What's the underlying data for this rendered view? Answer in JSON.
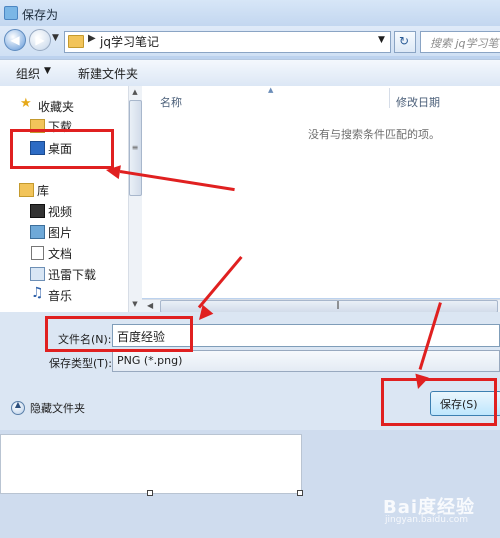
{
  "window": {
    "title": "保存为"
  },
  "address": {
    "crumb": "jq学习笔记",
    "search_placeholder": "搜索 jq学习笔记"
  },
  "toolbar": {
    "organize_label": "组织",
    "new_folder_label": "新建文件夹"
  },
  "nav": {
    "favorites_label": "收藏夹",
    "downloads_label": "下载",
    "desktop_label": "桌面",
    "libraries_label": "库",
    "videos_label": "视频",
    "pictures_label": "图片",
    "documents_label": "文档",
    "thunder_label": "迅雷下载",
    "music_label": "音乐"
  },
  "list": {
    "col_name": "名称",
    "col_date": "修改日期",
    "empty_message": "没有与搜索条件匹配的项。"
  },
  "form": {
    "filename_label": "文件名(N):",
    "filename_value": "百度经验",
    "filetype_label": "保存类型(T):",
    "filetype_value": "PNG (*.png)",
    "hide_folders_label": "隐藏文件夹",
    "save_label": "保存(S)"
  },
  "watermark": {
    "main": "Bai度经验",
    "sub": "jingyan.baidu.com"
  },
  "colors": {
    "callout_red": "#e02020",
    "frame_blue": "#bcd2ee"
  },
  "icons": [
    "back-arrow-icon",
    "forward-arrow-icon",
    "folder-icon",
    "refresh-icon",
    "star-icon",
    "download-folder-icon",
    "desktop-icon",
    "library-icon",
    "video-icon",
    "picture-icon",
    "document-icon",
    "thunder-icon",
    "music-note-icon",
    "chevron-up-icon"
  ]
}
